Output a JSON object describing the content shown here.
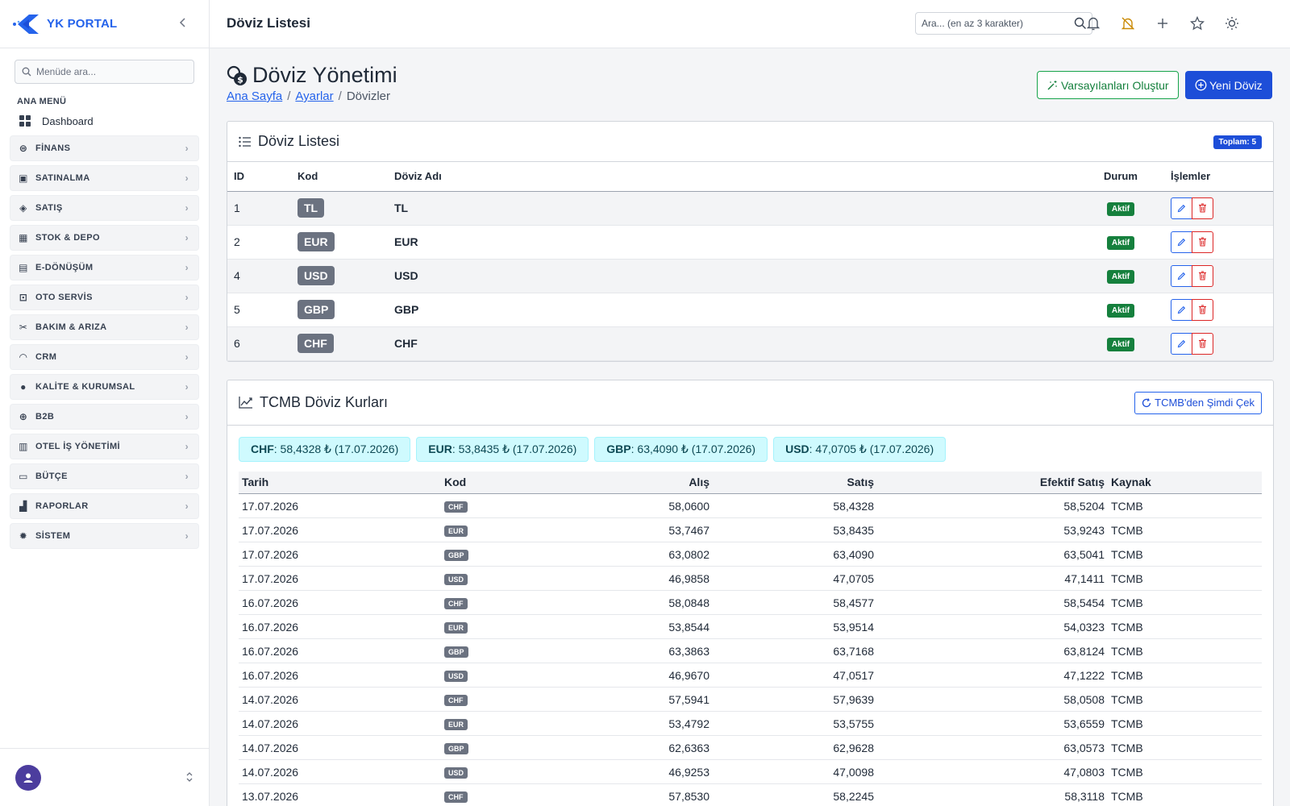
{
  "brand": {
    "name": "YK PORTAL"
  },
  "sidebar": {
    "search_placeholder": "Menüde ara...",
    "menu_title": "ANA MENÜ",
    "dashboard": "Dashboard",
    "items": [
      {
        "label": "FİNANS",
        "icon": "finance-icon"
      },
      {
        "label": "SATINALMA",
        "icon": "shopping-bag-icon"
      },
      {
        "label": "SATIŞ",
        "icon": "tag-icon"
      },
      {
        "label": "STOK & DEPO",
        "icon": "box-icon"
      },
      {
        "label": "E-DÖNÜŞÜM",
        "icon": "document-icon"
      },
      {
        "label": "OTO SERVİS",
        "icon": "car-icon"
      },
      {
        "label": "BAKIM & ARIZA",
        "icon": "tools-icon"
      },
      {
        "label": "CRM",
        "icon": "headset-icon"
      },
      {
        "label": "KALİTE & KURUMSAL",
        "icon": "quality-icon"
      },
      {
        "label": "B2B",
        "icon": "globe-icon"
      },
      {
        "label": "OTEL İŞ YÖNETİMİ",
        "icon": "building-icon"
      },
      {
        "label": "BÜTÇE",
        "icon": "wallet-icon"
      },
      {
        "label": "RAPORLAR",
        "icon": "bar-chart-icon"
      },
      {
        "label": "SİSTEM",
        "icon": "gear-icon"
      }
    ]
  },
  "topbar": {
    "title": "Döviz Listesi",
    "search_placeholder": "Ara... (en az 3 karakter)"
  },
  "page": {
    "title": "Döviz Yönetimi",
    "breadcrumb": [
      "Ana Sayfa",
      "Ayarlar",
      "Dövizler"
    ],
    "btn_defaults": "Varsayılanları Oluştur",
    "btn_new": "Yeni Döviz"
  },
  "currency_card": {
    "title": "Döviz Listesi",
    "total_badge": "Toplam: 5",
    "columns": [
      "ID",
      "Kod",
      "Döviz Adı",
      "Durum",
      "İşlemler"
    ],
    "rows": [
      {
        "id": "1",
        "code": "TL",
        "name": "TL",
        "status": "Aktif"
      },
      {
        "id": "2",
        "code": "EUR",
        "name": "EUR",
        "status": "Aktif"
      },
      {
        "id": "4",
        "code": "USD",
        "name": "USD",
        "status": "Aktif"
      },
      {
        "id": "5",
        "code": "GBP",
        "name": "GBP",
        "status": "Aktif"
      },
      {
        "id": "6",
        "code": "CHF",
        "name": "CHF",
        "status": "Aktif"
      }
    ]
  },
  "rates_card": {
    "title": "TCMB Döviz Kurları",
    "btn_fetch": "TCMB'den Şimdi Çek",
    "chips": [
      {
        "code": "CHF",
        "text": ": 58,4328 ₺ (17.07.2026)"
      },
      {
        "code": "EUR",
        "text": ": 53,8435 ₺ (17.07.2026)"
      },
      {
        "code": "GBP",
        "text": ": 63,4090 ₺ (17.07.2026)"
      },
      {
        "code": "USD",
        "text": ": 47,0705 ₺ (17.07.2026)"
      }
    ],
    "columns": [
      "Tarih",
      "Kod",
      "Alış",
      "Satış",
      "Efektif Satış",
      "Kaynak"
    ],
    "rows": [
      {
        "date": "17.07.2026",
        "code": "CHF",
        "buy": "58,0600",
        "sell": "58,4328",
        "eff": "58,5204",
        "src": "TCMB"
      },
      {
        "date": "17.07.2026",
        "code": "EUR",
        "buy": "53,7467",
        "sell": "53,8435",
        "eff": "53,9243",
        "src": "TCMB"
      },
      {
        "date": "17.07.2026",
        "code": "GBP",
        "buy": "63,0802",
        "sell": "63,4090",
        "eff": "63,5041",
        "src": "TCMB"
      },
      {
        "date": "17.07.2026",
        "code": "USD",
        "buy": "46,9858",
        "sell": "47,0705",
        "eff": "47,1411",
        "src": "TCMB"
      },
      {
        "date": "16.07.2026",
        "code": "CHF",
        "buy": "58,0848",
        "sell": "58,4577",
        "eff": "58,5454",
        "src": "TCMB"
      },
      {
        "date": "16.07.2026",
        "code": "EUR",
        "buy": "53,8544",
        "sell": "53,9514",
        "eff": "54,0323",
        "src": "TCMB"
      },
      {
        "date": "16.07.2026",
        "code": "GBP",
        "buy": "63,3863",
        "sell": "63,7168",
        "eff": "63,8124",
        "src": "TCMB"
      },
      {
        "date": "16.07.2026",
        "code": "USD",
        "buy": "46,9670",
        "sell": "47,0517",
        "eff": "47,1222",
        "src": "TCMB"
      },
      {
        "date": "14.07.2026",
        "code": "CHF",
        "buy": "57,5941",
        "sell": "57,9639",
        "eff": "58,0508",
        "src": "TCMB"
      },
      {
        "date": "14.07.2026",
        "code": "EUR",
        "buy": "53,4792",
        "sell": "53,5755",
        "eff": "53,6559",
        "src": "TCMB"
      },
      {
        "date": "14.07.2026",
        "code": "GBP",
        "buy": "62,6363",
        "sell": "62,9628",
        "eff": "63,0573",
        "src": "TCMB"
      },
      {
        "date": "14.07.2026",
        "code": "USD",
        "buy": "46,9253",
        "sell": "47,0098",
        "eff": "47,0803",
        "src": "TCMB"
      },
      {
        "date": "13.07.2026",
        "code": "CHF",
        "buy": "57,8530",
        "sell": "58,2245",
        "eff": "58,3118",
        "src": "TCMB"
      }
    ]
  }
}
